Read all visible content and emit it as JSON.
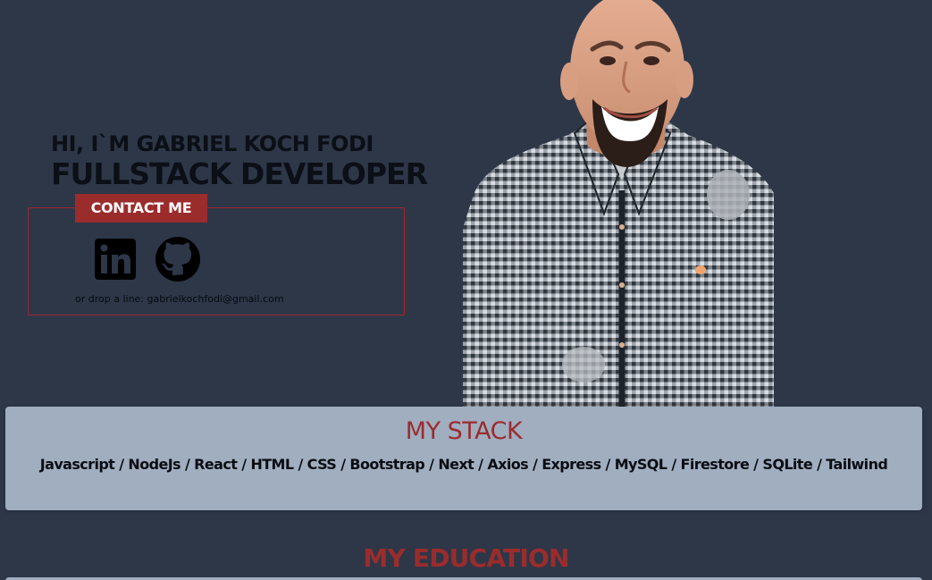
{
  "hero": {
    "greeting": "HI, I`M GABRIEL KOCH FODI",
    "role": "FULLSTACK DEVELOPER"
  },
  "contact": {
    "button_label": "CONTACT ME",
    "email_line": "or drop a line: gabrielkochfodi@gmail.com",
    "social_links": [
      {
        "name": "LinkedIn",
        "icon": "linkedin-icon"
      },
      {
        "name": "GitHub",
        "icon": "github-icon"
      }
    ]
  },
  "profile_photo": {
    "subject": "portrait of smiling man in checkered shirt"
  },
  "stack": {
    "title": "MY STACK",
    "items": "Javascript / NodeJs / React / HTML / CSS / Bootstrap / Next / Axios / Express / MySQL / Firestore / SQLite / Tailwind"
  },
  "education": {
    "title": "MY EDUCATION"
  },
  "colors": {
    "background": "#2d3748",
    "accent": "#9b2c2c",
    "panel": "#a0aec0",
    "text": "#0b0f16"
  }
}
